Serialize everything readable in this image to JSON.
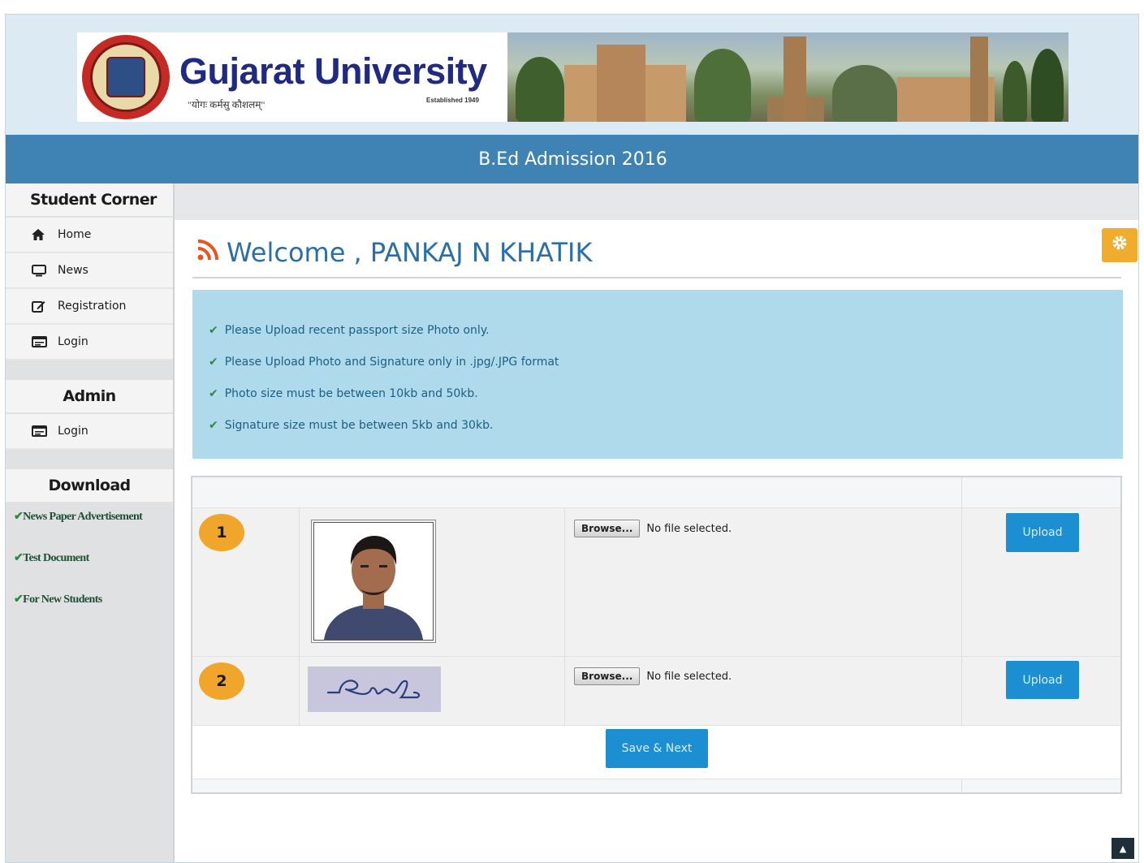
{
  "header": {
    "university_name": "Gujarat University",
    "motto": "\"योगः कर्मसु कौशलम्\"",
    "established": "Established 1949",
    "title": "B.Ed Admission 2016"
  },
  "sidebar": {
    "student_corner": {
      "heading": "Student Corner",
      "items": [
        {
          "label": "Home",
          "icon": "home-icon"
        },
        {
          "label": "News",
          "icon": "monitor-icon"
        },
        {
          "label": "Registration",
          "icon": "edit-icon"
        },
        {
          "label": "Login",
          "icon": "id-card-icon"
        }
      ]
    },
    "admin": {
      "heading": "Admin",
      "items": [
        {
          "label": "Login",
          "icon": "id-card-icon"
        }
      ]
    },
    "download": {
      "heading": "Download",
      "items": [
        {
          "label": "News Paper Advertisement"
        },
        {
          "label": "Test Document"
        },
        {
          "label": "For New Students"
        }
      ]
    }
  },
  "main": {
    "welcome": "Welcome , PANKAJ N KHATIK",
    "instructions": [
      "Please Upload recent passport size Photo only.",
      "Please Upload Photo and Signature only in .jpg/.JPG format",
      "Photo size must be between 10kb and 50kb.",
      "Signature size must be between 5kb and 30kb."
    ],
    "uploads": [
      {
        "index": "1",
        "browse_label": "Browse...",
        "status": "No file selected.",
        "upload_label": "Upload"
      },
      {
        "index": "2",
        "browse_label": "Browse...",
        "status": "No file selected.",
        "upload_label": "Upload"
      }
    ],
    "save_label": "Save & Next"
  },
  "colors": {
    "title_bar": "#3e83b4",
    "info_box": "#aedaec",
    "badge": "#f0a62b",
    "button": "#1c8fd3",
    "gear": "#f0ad2d",
    "welcome_text": "#2a6fa5"
  }
}
